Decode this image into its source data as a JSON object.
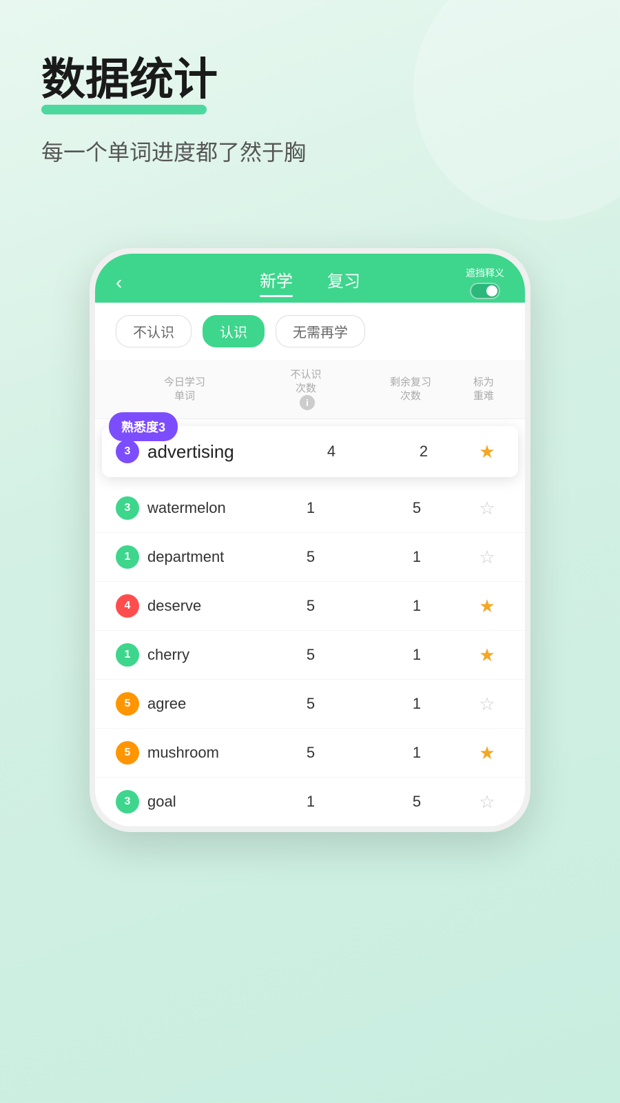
{
  "page": {
    "title": "数据统计",
    "subtitle": "每一个单词进度都了然于胸",
    "bg_circle": true
  },
  "phone": {
    "nav": {
      "back_icon": "‹",
      "tab_new": "新学",
      "tab_review": "复习",
      "toggle_label": "遮挡释义",
      "active_tab": "新学"
    },
    "filters": [
      {
        "label": "不认识",
        "active": false
      },
      {
        "label": "认识",
        "active": true
      },
      {
        "label": "无需再学",
        "active": false
      }
    ],
    "table_headers": {
      "col1_line1": "今日学习",
      "col1_line2": "单词",
      "col2_line1": "不认识",
      "col2_line2": "次数",
      "col3_line1": "剩余复习",
      "col3_line2": "次数",
      "col4": "标为重难"
    },
    "highlighted_word": {
      "tooltip": "熟悉度3",
      "badge": "3",
      "badge_color": "purple",
      "word": "advertising",
      "count": "4",
      "review": "2",
      "starred": true
    },
    "words": [
      {
        "badge": "3",
        "badge_color": "green",
        "word": "watermelon",
        "count": "1",
        "review": "5",
        "starred": false
      },
      {
        "badge": "1",
        "badge_color": "green",
        "word": "department",
        "count": "5",
        "review": "1",
        "starred": false
      },
      {
        "badge": "4",
        "badge_color": "red",
        "word": "deserve",
        "count": "5",
        "review": "1",
        "starred": true
      },
      {
        "badge": "1",
        "badge_color": "green",
        "word": "cherry",
        "count": "5",
        "review": "1",
        "starred": true
      },
      {
        "badge": "5",
        "badge_color": "orange",
        "word": "agree",
        "count": "5",
        "review": "1",
        "starred": false
      },
      {
        "badge": "5",
        "badge_color": "orange",
        "word": "mushroom",
        "count": "5",
        "review": "1",
        "starred": true
      },
      {
        "badge": "3",
        "badge_color": "green",
        "word": "goal",
        "count": "1",
        "review": "5",
        "starred": false
      }
    ]
  }
}
